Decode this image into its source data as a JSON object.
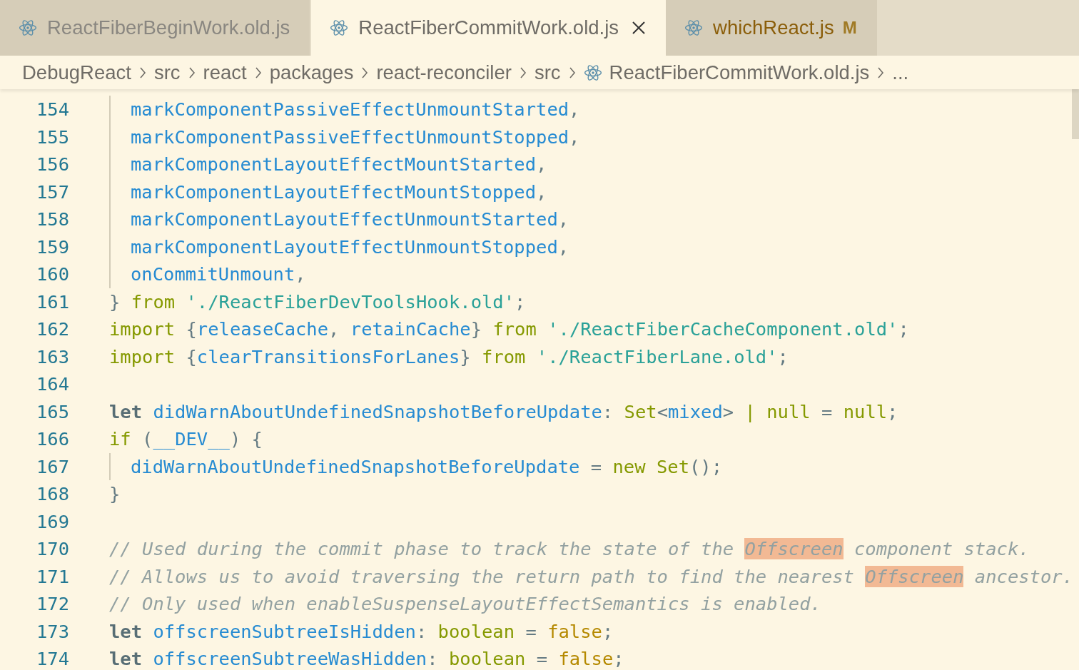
{
  "tabs": [
    {
      "label": "ReactFiberBeginWork.old.js",
      "selected": false,
      "modified": false
    },
    {
      "label": "ReactFiberCommitWork.old.js",
      "selected": true,
      "modified": false
    },
    {
      "label": "whichReact.js",
      "selected": false,
      "modified": true,
      "badge": "M"
    }
  ],
  "breadcrumb": [
    {
      "label": "DebugReact",
      "kind": "folder"
    },
    {
      "label": "src",
      "kind": "folder"
    },
    {
      "label": "react",
      "kind": "folder"
    },
    {
      "label": "packages",
      "kind": "folder"
    },
    {
      "label": "react-reconciler",
      "kind": "folder"
    },
    {
      "label": "src",
      "kind": "folder"
    },
    {
      "label": "ReactFiberCommitWork.old.js",
      "kind": "file"
    },
    {
      "label": "...",
      "kind": "more"
    }
  ],
  "code_lines": [
    {
      "number": "154",
      "guide": true,
      "tokens": [
        {
          "text": "markComponentPassiveEffectUnmountStarted",
          "kind": "name"
        },
        {
          "text": ",",
          "kind": "plain"
        }
      ]
    },
    {
      "number": "155",
      "guide": true,
      "tokens": [
        {
          "text": "markComponentPassiveEffectUnmountStopped",
          "kind": "name"
        },
        {
          "text": ",",
          "kind": "plain"
        }
      ]
    },
    {
      "number": "156",
      "guide": true,
      "tokens": [
        {
          "text": "markComponentLayoutEffectMountStarted",
          "kind": "name"
        },
        {
          "text": ",",
          "kind": "plain"
        }
      ]
    },
    {
      "number": "157",
      "guide": true,
      "tokens": [
        {
          "text": "markComponentLayoutEffectMountStopped",
          "kind": "name"
        },
        {
          "text": ",",
          "kind": "plain"
        }
      ]
    },
    {
      "number": "158",
      "guide": true,
      "tokens": [
        {
          "text": "markComponentLayoutEffectUnmountStarted",
          "kind": "name"
        },
        {
          "text": ",",
          "kind": "plain"
        }
      ]
    },
    {
      "number": "159",
      "guide": true,
      "tokens": [
        {
          "text": "markComponentLayoutEffectUnmountStopped",
          "kind": "name"
        },
        {
          "text": ",",
          "kind": "plain"
        }
      ]
    },
    {
      "number": "160",
      "guide": true,
      "tokens": [
        {
          "text": "onCommitUnmount",
          "kind": "name"
        },
        {
          "text": ",",
          "kind": "plain"
        }
      ]
    },
    {
      "number": "161",
      "guide": false,
      "tokens": [
        {
          "text": "} ",
          "kind": "plain"
        },
        {
          "text": "from",
          "kind": "keyword"
        },
        {
          "text": " './ReactFiberDevToolsHook.old'",
          "kind": "string"
        },
        {
          "text": ";",
          "kind": "plain"
        }
      ]
    },
    {
      "number": "162",
      "guide": false,
      "tokens": [
        {
          "text": "import",
          "kind": "keyword"
        },
        {
          "text": " {",
          "kind": "plain"
        },
        {
          "text": "releaseCache",
          "kind": "name"
        },
        {
          "text": ", ",
          "kind": "plain"
        },
        {
          "text": "retainCache",
          "kind": "name"
        },
        {
          "text": "} ",
          "kind": "plain"
        },
        {
          "text": "from",
          "kind": "keyword"
        },
        {
          "text": " './ReactFiberCacheComponent.old'",
          "kind": "string"
        },
        {
          "text": ";",
          "kind": "plain"
        }
      ]
    },
    {
      "number": "163",
      "guide": false,
      "tokens": [
        {
          "text": "import",
          "kind": "keyword"
        },
        {
          "text": " {",
          "kind": "plain"
        },
        {
          "text": "clearTransitionsForLanes",
          "kind": "name"
        },
        {
          "text": "} ",
          "kind": "plain"
        },
        {
          "text": "from",
          "kind": "keyword"
        },
        {
          "text": " './ReactFiberLane.old'",
          "kind": "string"
        },
        {
          "text": ";",
          "kind": "plain"
        }
      ]
    },
    {
      "number": "164",
      "guide": false
    },
    {
      "number": "165",
      "guide": false,
      "tokens": [
        {
          "text": "let",
          "kind": "storage"
        },
        {
          "text": " didWarnAboutUndefinedSnapshotBeforeUpdate",
          "kind": "name"
        },
        {
          "text": ": ",
          "kind": "plain"
        },
        {
          "text": "Set",
          "kind": "keyword"
        },
        {
          "text": "<",
          "kind": "plain"
        },
        {
          "text": "mixed",
          "kind": "name"
        },
        {
          "text": "> ",
          "kind": "plain"
        },
        {
          "text": "| null",
          "kind": "keyword"
        },
        {
          "text": " = ",
          "kind": "plain"
        },
        {
          "text": "null",
          "kind": "keyword"
        },
        {
          "text": ";",
          "kind": "plain"
        }
      ]
    },
    {
      "number": "166",
      "guide": false,
      "tokens": [
        {
          "text": "if",
          "kind": "keyword"
        },
        {
          "text": " (",
          "kind": "plain"
        },
        {
          "text": "__DEV__",
          "kind": "name"
        },
        {
          "text": ") {",
          "kind": "plain"
        }
      ]
    },
    {
      "number": "167",
      "guide": true,
      "tokens": [
        {
          "text": "didWarnAboutUndefinedSnapshotBeforeUpdate",
          "kind": "name"
        },
        {
          "text": " = ",
          "kind": "plain"
        },
        {
          "text": "new Set",
          "kind": "keyword"
        },
        {
          "text": "();",
          "kind": "plain"
        }
      ]
    },
    {
      "number": "168",
      "guide": false,
      "tokens": [
        {
          "text": "}",
          "kind": "plain"
        }
      ]
    },
    {
      "number": "169",
      "guide": false
    },
    {
      "number": "170",
      "guide": false,
      "tokens": [
        {
          "text": "// Used during the commit phase to track the state of the ",
          "kind": "comment"
        },
        {
          "text": "Offscreen",
          "kind": "match"
        },
        {
          "text": " component stack.",
          "kind": "comment"
        }
      ]
    },
    {
      "number": "171",
      "guide": false,
      "tokens": [
        {
          "text": "// Allows us to avoid traversing the return path to find the nearest ",
          "kind": "comment"
        },
        {
          "text": "Offscreen",
          "kind": "match"
        },
        {
          "text": " ancestor.",
          "kind": "comment"
        }
      ]
    },
    {
      "number": "172",
      "guide": false,
      "tokens": [
        {
          "text": "// Only used when enableSuspenseLayoutEffectSemantics is enabled.",
          "kind": "comment"
        }
      ]
    },
    {
      "number": "173",
      "guide": false,
      "tokens": [
        {
          "text": "let",
          "kind": "storage"
        },
        {
          "text": " offscreenSubtreeIsHidden",
          "kind": "name"
        },
        {
          "text": ": ",
          "kind": "plain"
        },
        {
          "text": "boolean",
          "kind": "keyword"
        },
        {
          "text": " = ",
          "kind": "plain"
        },
        {
          "text": "false",
          "kind": "literal"
        },
        {
          "text": ";",
          "kind": "plain"
        }
      ]
    },
    {
      "number": "174",
      "guide": false,
      "tokens": [
        {
          "text": "let",
          "kind": "storage"
        },
        {
          "text": " offscreenSubtreeWasHidden",
          "kind": "name"
        },
        {
          "text": ": ",
          "kind": "plain"
        },
        {
          "text": "boolean",
          "kind": "keyword"
        },
        {
          "text": " = ",
          "kind": "plain"
        },
        {
          "text": "false",
          "kind": "literal"
        },
        {
          "text": ";",
          "kind": "plain"
        }
      ]
    }
  ]
}
